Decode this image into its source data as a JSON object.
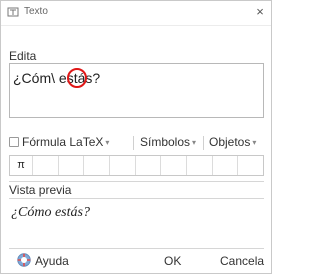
{
  "window": {
    "title": "Texto",
    "close_label": "×"
  },
  "editor": {
    "label": "Edita",
    "text_before": "¿Cóm",
    "text_marked": "\\",
    "text_after": " estás?"
  },
  "toolbar": {
    "latex_label": "Fórmula LaTeX",
    "latex_checked": false,
    "symbols_label": "Símbolos",
    "objects_label": "Objetos"
  },
  "symbol_grid": {
    "cells": [
      "π",
      "",
      "",
      "",
      "",
      "",
      "",
      "",
      "",
      ""
    ]
  },
  "preview": {
    "label": "Vista previa",
    "text": "¿Cómo estás?"
  },
  "buttons": {
    "help_label": "Ayuda",
    "ok_label": "OK",
    "cancel_label": "Cancela"
  },
  "colors": {
    "annotation_circle": "#e01717",
    "border": "#b8b8b8"
  }
}
